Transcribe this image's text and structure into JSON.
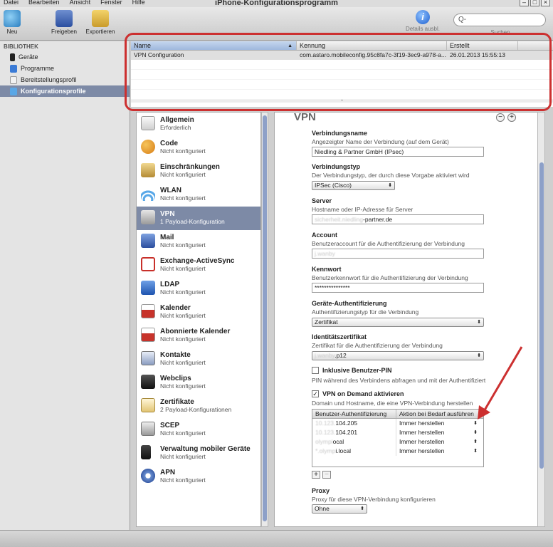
{
  "window": {
    "title": "iPhone-Konfigurationsprogramm"
  },
  "menu": [
    "Datei",
    "Bearbeiten",
    "Ansicht",
    "Fenster",
    "Hilfe"
  ],
  "toolbar": {
    "new": "Neu",
    "share": "Freigeben",
    "export": "Exportieren",
    "details": "Details ausbl.",
    "search_label": "Suchen",
    "search_placeholder": "Q-"
  },
  "sidebar": {
    "header": "BIBLIOTHEK",
    "items": [
      {
        "label": "Geräte",
        "icon": "device-icon"
      },
      {
        "label": "Programme",
        "icon": "app-icon"
      },
      {
        "label": "Bereitstellungsprofil",
        "icon": "provisioning-icon"
      },
      {
        "label": "Konfigurationsprofile",
        "icon": "config-profile-icon",
        "selected": true
      }
    ]
  },
  "profiles": {
    "columns": [
      "Name",
      "Kennung",
      "Erstellt"
    ],
    "rows": [
      {
        "name": "VPN Configuration",
        "id": "com.astaro.mobileconfig.95c8fa7c-3f19-3ec9-a978-a...",
        "created": "26.01.2013 15:55:13"
      }
    ]
  },
  "payloads": [
    {
      "title": "Allgemein",
      "subtitle": "Erforderlich",
      "icon": "general-icon"
    },
    {
      "title": "Code",
      "subtitle": "Nicht konfiguriert",
      "icon": "passcode-key-icon"
    },
    {
      "title": "Einschränkungen",
      "subtitle": "Nicht konfiguriert",
      "icon": "restrictions-lock-icon"
    },
    {
      "title": "WLAN",
      "subtitle": "Nicht konfiguriert",
      "icon": "wifi-icon"
    },
    {
      "title": "VPN",
      "subtitle": "1 Payload-Konfiguration",
      "icon": "vpn-lock-icon",
      "selected": true
    },
    {
      "title": "Mail",
      "subtitle": "Nicht konfiguriert",
      "icon": "mail-icon"
    },
    {
      "title": "Exchange-ActiveSync",
      "subtitle": "Nicht konfiguriert",
      "icon": "exchange-icon"
    },
    {
      "title": "LDAP",
      "subtitle": "Nicht konfiguriert",
      "icon": "ldap-icon"
    },
    {
      "title": "Kalender",
      "subtitle": "Nicht konfiguriert",
      "icon": "calendar-icon"
    },
    {
      "title": "Abonnierte Kalender",
      "subtitle": "Nicht konfiguriert",
      "icon": "subscribed-calendar-icon"
    },
    {
      "title": "Kontakte",
      "subtitle": "Nicht konfiguriert",
      "icon": "contacts-icon"
    },
    {
      "title": "Webclips",
      "subtitle": "Nicht konfiguriert",
      "icon": "webclip-icon"
    },
    {
      "title": "Zertifikate",
      "subtitle": "2 Payload-Konfigurationen",
      "icon": "certificate-icon"
    },
    {
      "title": "SCEP",
      "subtitle": "Nicht konfiguriert",
      "icon": "scep-icon"
    },
    {
      "title": "Verwaltung mobiler Geräte",
      "subtitle": "Nicht konfiguriert",
      "icon": "mdm-icon"
    },
    {
      "title": "APN",
      "subtitle": "Nicht konfiguriert",
      "icon": "apn-gear-icon"
    }
  ],
  "vpn": {
    "title": "VPN",
    "connection_name": {
      "label": "Verbindungsname",
      "desc": "Angezeigter Name der Verbindung (auf dem Gerät)",
      "value": "Niedling & Partner GmbH (IPsec)"
    },
    "connection_type": {
      "label": "Verbindungstyp",
      "desc": "Der Verbindungstyp, der durch diese Vorgabe aktiviert wird",
      "value": "IPSec (Cisco)"
    },
    "server": {
      "label": "Server",
      "desc": "Hostname oder IP-Adresse für Server",
      "value_blur": "sicherheit.niedling",
      "value": "-partner.de"
    },
    "account": {
      "label": "Account",
      "desc": "Benutzeraccount für die Authentifizierung der Verbindung",
      "value_blur": "j.wanby"
    },
    "password": {
      "label": "Kennwort",
      "desc": "Benutzerkennwort für die Authentifizierung der Verbindung",
      "value": "***************"
    },
    "device_auth": {
      "label": "Geräte-Authentifizierung",
      "desc": "Authentifizierungstyp für die Verbindung",
      "value": "Zertifikat"
    },
    "identity_cert": {
      "label": "Identitätszertifikat",
      "desc": "Zertifikat für die Authentifizierung der Verbindung",
      "value_blur": "j.wanby",
      "value": ".p12"
    },
    "user_pin": {
      "label": "Inklusive Benutzer-PIN",
      "desc": "PIN während des Verbindens abfragen und mit der Authentifiziert",
      "checked": false
    },
    "on_demand": {
      "label": "VPN on Demand aktivieren",
      "desc": "Domain und Hostname, die eine VPN-Verbindung herstellen",
      "checked": true
    },
    "on_demand_table": {
      "columns": [
        "Benutzer-Authentifizierung",
        "Aktion bei Bedarf ausführen"
      ],
      "rows": [
        {
          "blur": "10.123.",
          "host": "104.205",
          "action": "Immer herstellen"
        },
        {
          "blur": "10.123.",
          "host": "104.201",
          "action": "Immer herstellen"
        },
        {
          "blur": "olympi",
          "host": "ocal",
          "action": "Immer herstellen"
        },
        {
          "blur": "*.olymp",
          "host": "i.local",
          "action": "Immer herstellen"
        }
      ]
    },
    "proxy": {
      "label": "Proxy",
      "desc": "Proxy für diese VPN-Verbindung konfigurieren",
      "value": "Ohne"
    }
  },
  "colors": {
    "selection": "#7d8aa6",
    "annotation": "#cc3030"
  }
}
